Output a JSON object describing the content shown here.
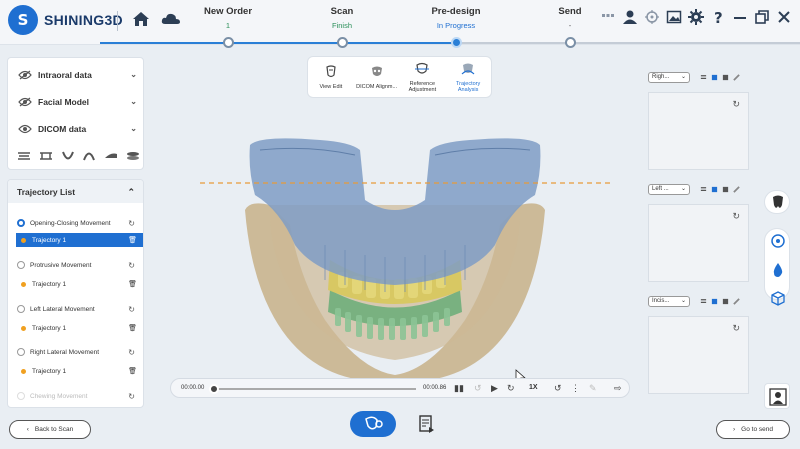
{
  "app": {
    "name": "SHINING3D",
    "logo_letter": "S"
  },
  "header_icons": [
    "home-icon",
    "cloud-icon"
  ],
  "steps": [
    {
      "title": "New Order",
      "status": "1"
    },
    {
      "title": "Scan",
      "status": "Finish"
    },
    {
      "title": "Pre-design",
      "status": "In Progress"
    },
    {
      "title": "Send",
      "status": "-"
    }
  ],
  "window_icons": [
    "grid-icon",
    "user-icon",
    "target-icon",
    "image-icon",
    "gear-icon",
    "help-icon",
    "minimize-icon",
    "restore-icon",
    "close-icon"
  ],
  "left_panel": {
    "data_items": [
      {
        "label": "Intraoral data"
      },
      {
        "label": "Facial Model"
      },
      {
        "label": "DICOM data"
      }
    ],
    "jaw_tools": [
      "upper-jaw-icon",
      "bite-icon",
      "lower-arch-icon",
      "upper-arch-icon",
      "side-view-icon",
      "stack-icon"
    ]
  },
  "trajectory": {
    "title": "Trajectory List",
    "movements": [
      {
        "label": "Opening-Closing Movement",
        "selected": true,
        "trajectory": "Trajectory 1",
        "trajectory_selected": true
      },
      {
        "label": "Protrusive Movement",
        "selected": false,
        "trajectory": "Trajectory 1",
        "trajectory_selected": false
      },
      {
        "label": "Left Lateral Movement",
        "selected": false,
        "trajectory": "Trajectory 1",
        "trajectory_selected": false
      },
      {
        "label": "Right Lateral Movement",
        "selected": false,
        "trajectory": "Trajectory 1",
        "trajectory_selected": false
      },
      {
        "label": "Chewing Movement",
        "selected": false
      }
    ]
  },
  "toolbar": {
    "items": [
      {
        "label": "View Edit",
        "icon": "view-edit-icon"
      },
      {
        "label": "DICOM Alignm...",
        "icon": "dicom-align-icon"
      },
      {
        "label": "Reference Adjustment",
        "icon": "reference-icon"
      },
      {
        "label": "Trajectory Analysis",
        "icon": "trajectory-icon",
        "active": true
      }
    ]
  },
  "playback": {
    "current_time": "00:00.00",
    "total_time": "00:00.86",
    "speed": "1X",
    "progress": 0.0
  },
  "right_panels": [
    {
      "view": "Righ..."
    },
    {
      "view": "Left ..."
    },
    {
      "view": "Incis..."
    }
  ],
  "footer": {
    "back_label": "Back to Scan",
    "next_label": "Go to send"
  },
  "colors": {
    "accent": "#1f6fd1",
    "upper_jaw": "#7f9cc4",
    "lower_jaw": "#c9b48e",
    "upper_teeth": "#d8c85a",
    "lower_teeth": "#6fae7a",
    "guide_line": "#e89a3a"
  }
}
